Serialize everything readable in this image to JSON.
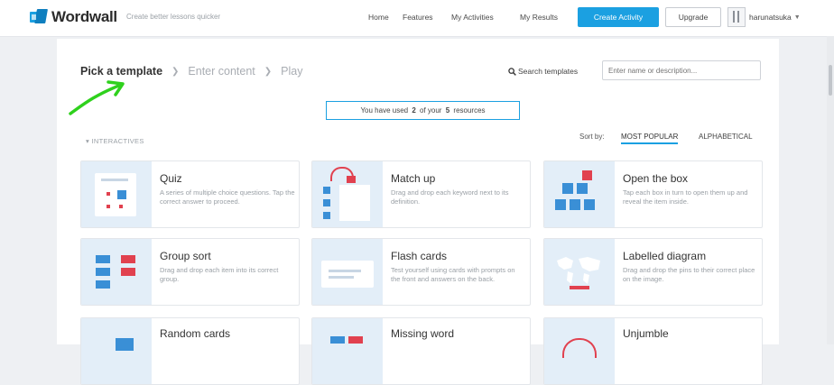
{
  "header": {
    "logo_text": "Wordwall",
    "tagline": "Create better lessons quicker",
    "nav": [
      "Home",
      "Features",
      "My Activities",
      "My Results"
    ],
    "create_button": "Create Activity",
    "upgrade_button": "Upgrade",
    "username": "harunatsuka",
    "brand_color": "#1ba0e1"
  },
  "wizard": {
    "steps": [
      "Pick a template",
      "Enter content",
      "Play"
    ],
    "search_label": "Search templates",
    "search_placeholder": "Enter name or description..."
  },
  "usage": {
    "text_before": "You have used",
    "used": "2",
    "text_middle": "of your",
    "total": "5",
    "text_after": "resources"
  },
  "section_label": "INTERACTIVES",
  "sort": {
    "label": "Sort by:",
    "options": [
      "MOST POPULAR",
      "ALPHABETICAL"
    ],
    "selected": "MOST POPULAR"
  },
  "templates": [
    {
      "title": "Quiz",
      "description": "A series of multiple choice questions. Tap the correct answer to proceed."
    },
    {
      "title": "Match up",
      "description": "Drag and drop each keyword next to its definition."
    },
    {
      "title": "Open the box",
      "description": "Tap each box in turn to open them up and reveal the item inside."
    },
    {
      "title": "Group sort",
      "description": "Drag and drop each item into its correct group."
    },
    {
      "title": "Flash cards",
      "description": "Test yourself using cards with prompts on the front and answers on the back."
    },
    {
      "title": "Labelled diagram",
      "description": "Drag and drop the pins to their correct place on the image."
    },
    {
      "title": "Random cards",
      "description": ""
    },
    {
      "title": "Missing word",
      "description": ""
    },
    {
      "title": "Unjumble",
      "description": ""
    }
  ]
}
